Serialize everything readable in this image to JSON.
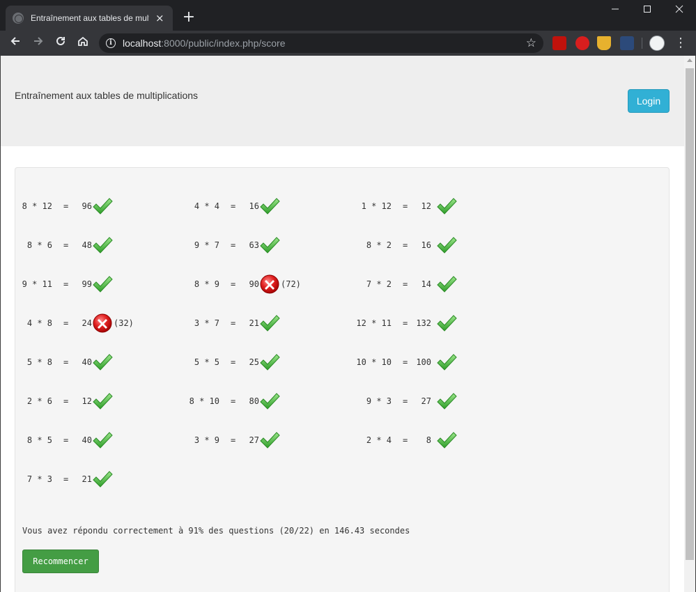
{
  "browser": {
    "tab_title": "Entraînement aux tables de multiplications",
    "url_host": "localhost",
    "url_rest": ":8000/public/index.php/score",
    "new_tab_label": "+",
    "close_tab_label": "×"
  },
  "page": {
    "app_title": "Entraînement aux tables de multiplications",
    "login_label": "Login",
    "summary": "Vous avez répondu correctement à 91% des questions (20/22) en 146.43 secondes",
    "restart_label": "Recommencer"
  },
  "questions": [
    [
      {
        "q": "8 * 12",
        "a": "96",
        "ok": true,
        "correct": ""
      },
      {
        "q": "8 * 6",
        "a": "48",
        "ok": true,
        "correct": ""
      },
      {
        "q": "9 * 11",
        "a": "99",
        "ok": true,
        "correct": ""
      },
      {
        "q": "4 * 8",
        "a": "24",
        "ok": false,
        "correct": "(32)"
      },
      {
        "q": "5 * 8",
        "a": "40",
        "ok": true,
        "correct": ""
      },
      {
        "q": "2 * 6",
        "a": "12",
        "ok": true,
        "correct": ""
      },
      {
        "q": "8 * 5",
        "a": "40",
        "ok": true,
        "correct": ""
      },
      {
        "q": "7 * 3",
        "a": "21",
        "ok": true,
        "correct": ""
      }
    ],
    [
      {
        "q": "4 * 4",
        "a": "16",
        "ok": true,
        "correct": ""
      },
      {
        "q": "9 * 7",
        "a": "63",
        "ok": true,
        "correct": ""
      },
      {
        "q": "8 * 9",
        "a": "90",
        "ok": false,
        "correct": "(72)"
      },
      {
        "q": "3 * 7",
        "a": "21",
        "ok": true,
        "correct": ""
      },
      {
        "q": "5 * 5",
        "a": "25",
        "ok": true,
        "correct": ""
      },
      {
        "q": "8 * 10",
        "a": "80",
        "ok": true,
        "correct": ""
      },
      {
        "q": "3 * 9",
        "a": "27",
        "ok": true,
        "correct": ""
      }
    ],
    [
      {
        "q": "1 * 12",
        "a": "12",
        "ok": true,
        "correct": ""
      },
      {
        "q": "8 * 2",
        "a": "16",
        "ok": true,
        "correct": ""
      },
      {
        "q": "7 * 2",
        "a": "14",
        "ok": true,
        "correct": ""
      },
      {
        "q": "12 * 11",
        "a": "132",
        "ok": true,
        "correct": ""
      },
      {
        "q": "10 * 10",
        "a": "100",
        "ok": true,
        "correct": ""
      },
      {
        "q": "9 * 3",
        "a": "27",
        "ok": true,
        "correct": ""
      },
      {
        "q": "2 * 4",
        "a": "8",
        "ok": true,
        "correct": ""
      }
    ]
  ],
  "equals": "=",
  "colors": {
    "check": "#4cc43c",
    "cross": "#e02020",
    "login_bg": "#31b0d5",
    "restart_bg": "#449d44"
  },
  "icons": {
    "right_answer": "checkmark-icon",
    "wrong_answer": "cross-icon"
  }
}
